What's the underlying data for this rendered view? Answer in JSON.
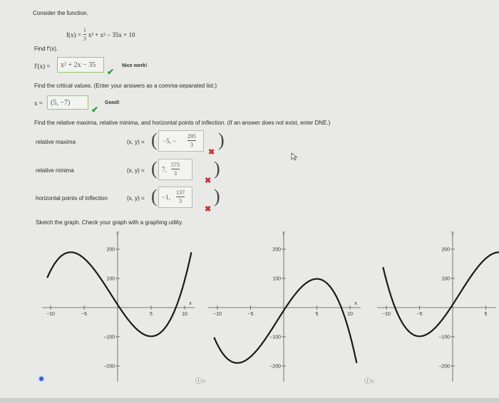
{
  "prompt": "Consider the function.",
  "function": {
    "lhs": "f(x) =",
    "frac_num": "1",
    "frac_den": "3",
    "rest": "x³ + x² − 35x + 10"
  },
  "part1": {
    "question": "Find f'(x).",
    "label": "f'(x) =",
    "answer": "x² + 2x − 35",
    "feedback": "Nice work!"
  },
  "part2": {
    "question": "Find the critical values. (Enter your answers as a comma-separated list.)",
    "label": "x =",
    "answer": "(5, −7)",
    "feedback": "Good!"
  },
  "part3": {
    "question": "Find the relative maxima, relative minima, and horizontal points of inflection. (If an answer does not exist, enter DNE.)",
    "xy_label": "(x, y) =",
    "rows": [
      {
        "label": "relative maxima",
        "prefix": "−5, −",
        "num": "295",
        "den": "3"
      },
      {
        "label": "relative minima",
        "prefix": "7,",
        "num": "573",
        "den": "3"
      },
      {
        "label": "horizontal points of inflection",
        "prefix": "−1,",
        "num": "137",
        "den": "3"
      }
    ]
  },
  "sketch": {
    "instruction": "Sketch the graph. Check your graph with a graphing utility.",
    "graph_labels": {
      "y_axis": "y",
      "x_axis": "x",
      "y_ticks": [
        "200",
        "100",
        "−100",
        "−200"
      ],
      "x_ticks": [
        "−10",
        "−5",
        "5",
        "10"
      ]
    }
  },
  "colors": {
    "correct": "#2e9a3c",
    "incorrect": "#c9302c",
    "selected_radio": "#2c62d6"
  }
}
